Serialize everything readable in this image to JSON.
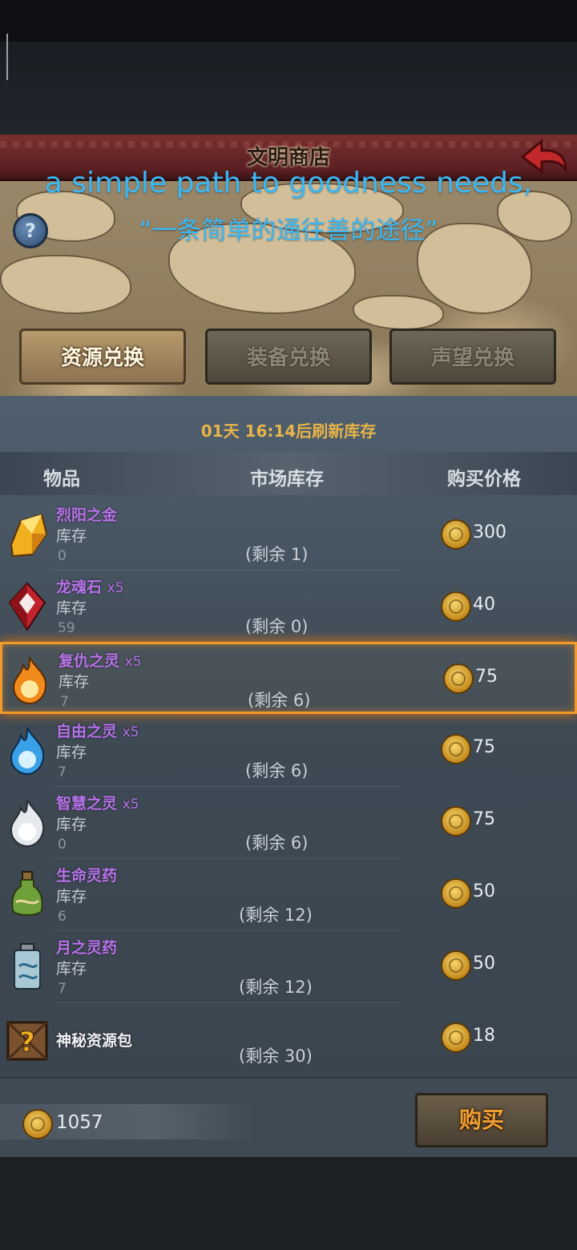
{
  "header": {
    "title": "文明商店",
    "subtitle_en": "a simple path to goodness needs,",
    "subtitle_zh": "“一条简单的通往善的途径”",
    "help_label": "?"
  },
  "tabs": [
    {
      "label": "资源兑换",
      "active": true
    },
    {
      "label": "装备兑换",
      "active": false
    },
    {
      "label": "声望兑换",
      "active": false
    }
  ],
  "refresh_text": "01天 16:14后刷新库存",
  "columns": {
    "item": "物品",
    "stock": "市场库存",
    "price": "购买价格"
  },
  "items": [
    {
      "name": "烈阳之金",
      "qty": "",
      "stock_label": "库存",
      "stock": "0",
      "remaining": "(剩余 1)",
      "price": "300",
      "icon": "golden-crystal-icon"
    },
    {
      "name": "龙魂石",
      "qty": "x5",
      "stock_label": "库存",
      "stock": "59",
      "remaining": "(剩余 0)",
      "price": "40",
      "icon": "red-gem-icon"
    },
    {
      "name": "复仇之灵",
      "qty": "x5",
      "stock_label": "库存",
      "stock": "7",
      "remaining": "(剩余 6)",
      "price": "75",
      "icon": "orange-flame-icon",
      "selected": true
    },
    {
      "name": "自由之灵",
      "qty": "x5",
      "stock_label": "库存",
      "stock": "7",
      "remaining": "(剩余 6)",
      "price": "75",
      "icon": "blue-flame-icon"
    },
    {
      "name": "智慧之灵",
      "qty": "x5",
      "stock_label": "库存",
      "stock": "0",
      "remaining": "(剩余 6)",
      "price": "75",
      "icon": "white-flame-icon"
    },
    {
      "name": "生命灵药",
      "qty": "",
      "stock_label": "库存",
      "stock": "6",
      "remaining": "(剩余 12)",
      "price": "50",
      "icon": "life-potion-icon"
    },
    {
      "name": "月之灵药",
      "qty": "",
      "stock_label": "库存",
      "stock": "7",
      "remaining": "(剩余 12)",
      "price": "50",
      "icon": "moon-potion-icon"
    },
    {
      "name": "神秘资源包",
      "qty": "",
      "stock_label": "",
      "stock": "",
      "remaining": "(剩余 30)",
      "price": "18",
      "icon": "mystery-crate-icon"
    }
  ],
  "footer": {
    "balance": "1057",
    "buy_label": "购买"
  },
  "colors": {
    "accent_gold": "#e8b44a",
    "item_purple": "#b675e8",
    "subtitle_blue": "#3ab8f5",
    "selection_orange": "#f29a2a"
  }
}
